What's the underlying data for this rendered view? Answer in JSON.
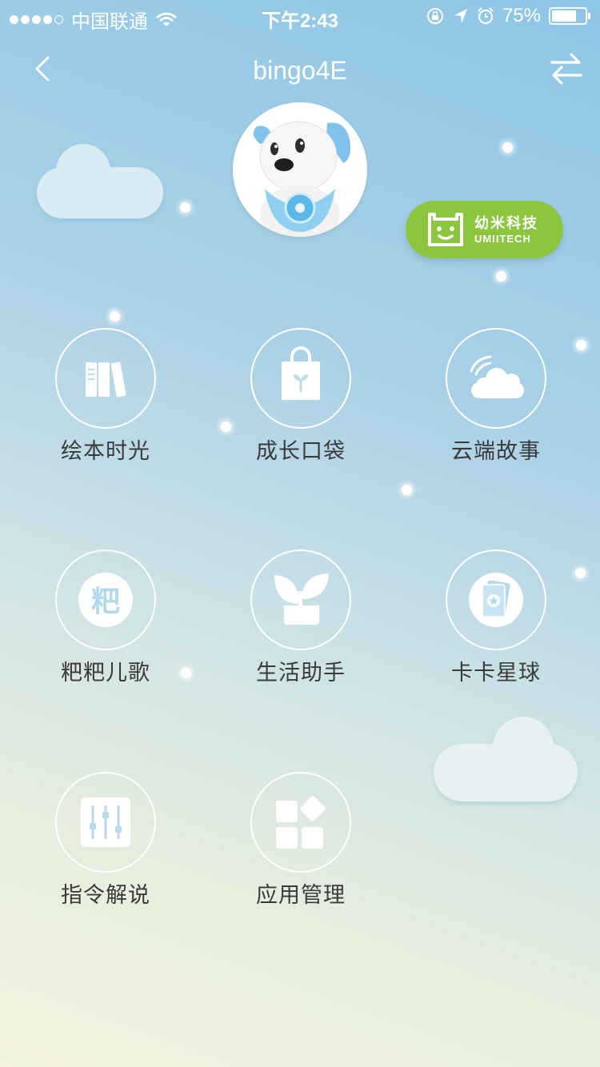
{
  "status_bar": {
    "carrier": "中国联通",
    "time": "下午2:43",
    "battery": "75%",
    "battery_level": 0.75
  },
  "header": {
    "title": "bingo4E",
    "back_icon": "chevron-left-icon",
    "switch_icon": "swap-arrows-icon"
  },
  "brand": {
    "name_cn": "幼米科技",
    "name_en": "UMIITECH",
    "color": "#8cc63f"
  },
  "menu": [
    {
      "label": "绘本时光",
      "icon": "books-icon"
    },
    {
      "label": "成长口袋",
      "icon": "sprout-bag-icon"
    },
    {
      "label": "云端故事",
      "icon": "cloud-signal-icon"
    },
    {
      "label": "粑粑儿歌",
      "icon": "ba-character-icon",
      "icon_text": "粑"
    },
    {
      "label": "生活助手",
      "icon": "potted-plant-icon"
    },
    {
      "label": "卡卡星球",
      "icon": "star-card-icon"
    },
    {
      "label": "指令解说",
      "icon": "sliders-icon"
    },
    {
      "label": "应用管理",
      "icon": "app-grid-icon"
    }
  ]
}
